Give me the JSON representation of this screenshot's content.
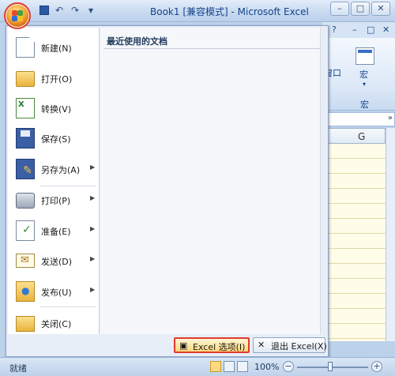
{
  "window": {
    "title": "Book1  [兼容模式] - Microsoft Excel",
    "controls": [
      "–",
      "□",
      "✕"
    ]
  },
  "quick_access": {
    "undo": "↶",
    "redo": "↷",
    "more": "▾"
  },
  "ribbon": {
    "tab_help": "?",
    "tab_min": "–",
    "tab_restore": "□",
    "tab_close": "✕",
    "group_window_label": "窗口",
    "macro_label": "宏",
    "macro_dropdown": "▾",
    "macro_group": "宏"
  },
  "grid": {
    "column_header": "G",
    "formula_expand": "»"
  },
  "office_menu": {
    "recent_title": "最近使用的文档",
    "items": [
      {
        "label": "新建(N)",
        "icon": "new-document-icon",
        "submenu": false
      },
      {
        "label": "打开(O)",
        "icon": "open-folder-icon",
        "submenu": false
      },
      {
        "label": "转换(V)",
        "icon": "convert-icon",
        "submenu": false
      },
      {
        "label": "保存(S)",
        "icon": "save-icon",
        "submenu": false
      },
      {
        "label": "另存为(A)",
        "icon": "save-as-icon",
        "submenu": true
      },
      {
        "label": "打印(P)",
        "icon": "print-icon",
        "submenu": true
      },
      {
        "label": "准备(E)",
        "icon": "prepare-icon",
        "submenu": true
      },
      {
        "label": "发送(D)",
        "icon": "send-icon",
        "submenu": true
      },
      {
        "label": "发布(U)",
        "icon": "publish-icon",
        "submenu": true
      },
      {
        "label": "关闭(C)",
        "icon": "close-folder-icon",
        "submenu": false
      }
    ],
    "submenu_arrow": "▶",
    "excel_options": "Excel 选项(I)",
    "exit_excel": "退出 Excel(X)"
  },
  "status": {
    "ready": "就绪",
    "zoom": "100%",
    "zoom_minus": "−",
    "zoom_plus": "+"
  }
}
